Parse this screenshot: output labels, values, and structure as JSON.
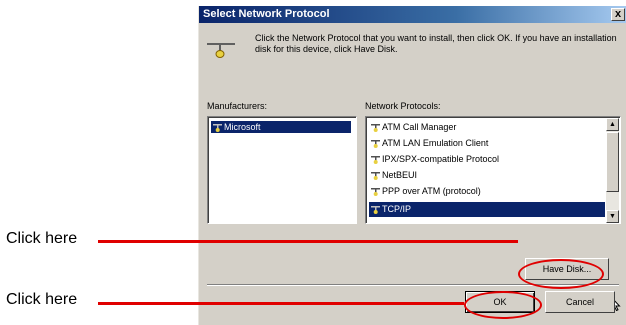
{
  "dialog": {
    "title": "Select Network Protocol",
    "close_glyph": "x",
    "instructions": "Click the Network Protocol that you want to install, then click OK. If you have an installation disk for this device, click Have Disk.",
    "manufacturers_label": "Manufacturers:",
    "protocols_label": "Network Protocols:",
    "manufacturers": [
      "Microsoft"
    ],
    "protocols": [
      "ATM Call Manager",
      "ATM LAN Emulation Client",
      "IPX/SPX-compatible Protocol",
      "NetBEUI",
      "PPP over ATM (protocol)",
      "TCP/IP"
    ],
    "selected_protocol": "TCP/IP",
    "have_disk_label": "Have Disk...",
    "ok_label": "OK",
    "cancel_label": "Cancel"
  },
  "annotations": {
    "label_1": "Click here",
    "label_2": "Click here",
    "color": "#e00000"
  }
}
